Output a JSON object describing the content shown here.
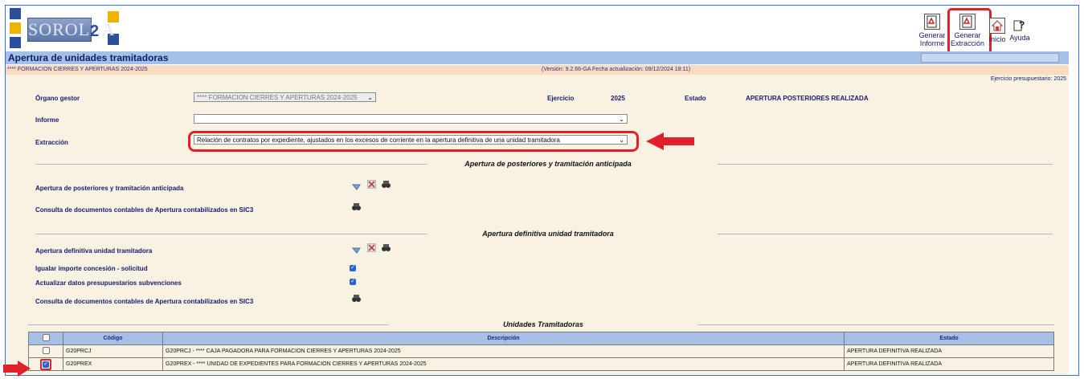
{
  "app": {
    "logo_text": "SOROLLA",
    "logo_suffix": "2"
  },
  "toolbar": {
    "generar_informe": "Generar Informe",
    "generar_extraccion": "Generar Extracción",
    "inicio": "Inicio",
    "ayuda": "Ayuda"
  },
  "header": {
    "title": "Apertura de unidades tramitadoras",
    "subtitle": "**** FORMACION CIERRES Y APERTURAS 2024-2025",
    "version": "(Versión: 9.2.66-GA Fecha actualización: 09/12/2024 18:11)",
    "ejercicio_presupuestario": "Ejercicio presupuestario: 2025"
  },
  "form": {
    "organo_gestor_label": "Órgano gestor",
    "organo_gestor_value": "**** FORMACION CIERRES Y APERTURAS 2024-2025",
    "ejercicio_label": "Ejercicio",
    "ejercicio_value": "2025",
    "estado_label": "Estado",
    "estado_value": "APERTURA POSTERIORES REALIZADA",
    "informe_label": "Informe",
    "informe_value": "",
    "extraccion_label": "Extracción",
    "extraccion_value": "Relación de contratos por expediente, ajustados en los excesos de corriente en la apertura definitiva de una unidad tramitadora"
  },
  "section1": {
    "title": "Apertura de posteriores y tramitación anticipada",
    "row1": "Apertura de posteriores y tramitación anticipada",
    "row2": "Consulta de documentos contables de Apertura contabilizados en SIC3"
  },
  "section2": {
    "title": "Apertura definitiva unidad tramitadora",
    "row1": "Apertura definitiva unidad tramitadora",
    "row2": "Igualar importe concesión - solicitud",
    "row3": "Actualizar datos presupuestarios subvenciones",
    "row4": "Consulta de documentos contables de Apertura contabilizados en SIC3"
  },
  "section3": {
    "title": "Unidades Tramitadoras",
    "columns": [
      "Código",
      "Descripción",
      "Estado"
    ],
    "rows": [
      {
        "codigo": "G20PRCJ",
        "descripcion": "G20PRCJ - **** CAJA PAGADORA PARA FORMACION CIERRES Y APERTURAS 2024-2025",
        "estado": "APERTURA DEFINITIVA REALIZADA",
        "checked": false
      },
      {
        "codigo": "G20PREX",
        "descripcion": "G20PREX - **** UNIDAD DE EXPEDIENTES PARA FORMACION CIERRES Y APERTURAS 2024-2025",
        "estado": "APERTURA DEFINITIVA REALIZADA",
        "checked": true
      }
    ]
  },
  "colors": {
    "accent": "#a5bfe6",
    "highlight": "#e0202a",
    "background": "#f7f2e2",
    "infobar": "#f9dcc0"
  }
}
